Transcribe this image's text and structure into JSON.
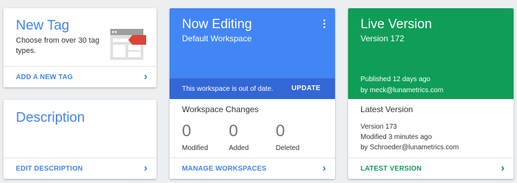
{
  "new_tag": {
    "title": "New Tag",
    "description": "Choose from over 30 tag types.",
    "link": "ADD A NEW TAG"
  },
  "description_card": {
    "title": "Description",
    "link": "EDIT DESCRIPTION"
  },
  "now_editing": {
    "title": "Now Editing",
    "workspace": "Default Workspace",
    "notice": "This workspace is out of date.",
    "update_label": "UPDATE",
    "changes_title": "Workspace Changes",
    "stats": [
      {
        "value": "0",
        "label": "Modified"
      },
      {
        "value": "0",
        "label": "Added"
      },
      {
        "value": "0",
        "label": "Deleted"
      }
    ],
    "link": "MANAGE WORKSPACES"
  },
  "live_version": {
    "title": "Live Version",
    "version": "Version 172",
    "published": "Published 12 days ago",
    "by": "by meck@lunametrics.com",
    "latest_title": "Latest Version",
    "latest_version": "Version 173",
    "latest_modified": "Modified 3 minutes ago",
    "latest_by": "by Schroeder@lunametrics.com",
    "link": "LATEST VERSION"
  },
  "colors": {
    "blue": "#4285f4",
    "blue_dark": "#3367d6",
    "green": "#0f9d58",
    "background": "#eceff1"
  },
  "icons": [
    "tag-illustration",
    "chevron-right-icon",
    "more-vert-icon"
  ]
}
